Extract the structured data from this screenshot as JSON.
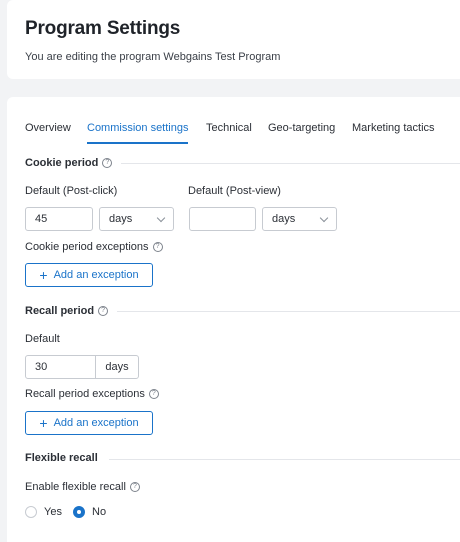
{
  "header": {
    "title": "Program Settings",
    "subtitle": "You are editing the program Webgains Test Program"
  },
  "tabs": [
    {
      "label": "Overview",
      "active": false
    },
    {
      "label": "Commission settings",
      "active": true
    },
    {
      "label": "Technical",
      "active": false
    },
    {
      "label": "Geo-targeting",
      "active": false
    },
    {
      "label": "Marketing tactics",
      "active": false
    }
  ],
  "cookie_period": {
    "title": "Cookie period",
    "post_click_label": "Default (Post-click)",
    "post_click_value": "45",
    "post_click_unit": "days",
    "post_view_label": "Default (Post-view)",
    "post_view_value": "",
    "post_view_unit": "days",
    "exceptions_label": "Cookie period exceptions",
    "add_exception_label": "Add an exception"
  },
  "recall_period": {
    "title": "Recall period",
    "default_label": "Default",
    "default_value": "30",
    "default_unit": "days",
    "exceptions_label": "Recall period exceptions",
    "add_exception_label": "Add an exception"
  },
  "flexible_recall": {
    "title": "Flexible recall",
    "enable_label": "Enable flexible recall",
    "options": [
      {
        "label": "Yes",
        "selected": false
      },
      {
        "label": "No",
        "selected": true
      }
    ]
  },
  "colors": {
    "accent": "#1a73c9",
    "background": "#f2f3f5",
    "card": "#ffffff"
  },
  "icons": {
    "help": "question-circle-icon",
    "add": "plus-icon",
    "dropdown": "chevron-down-icon"
  }
}
